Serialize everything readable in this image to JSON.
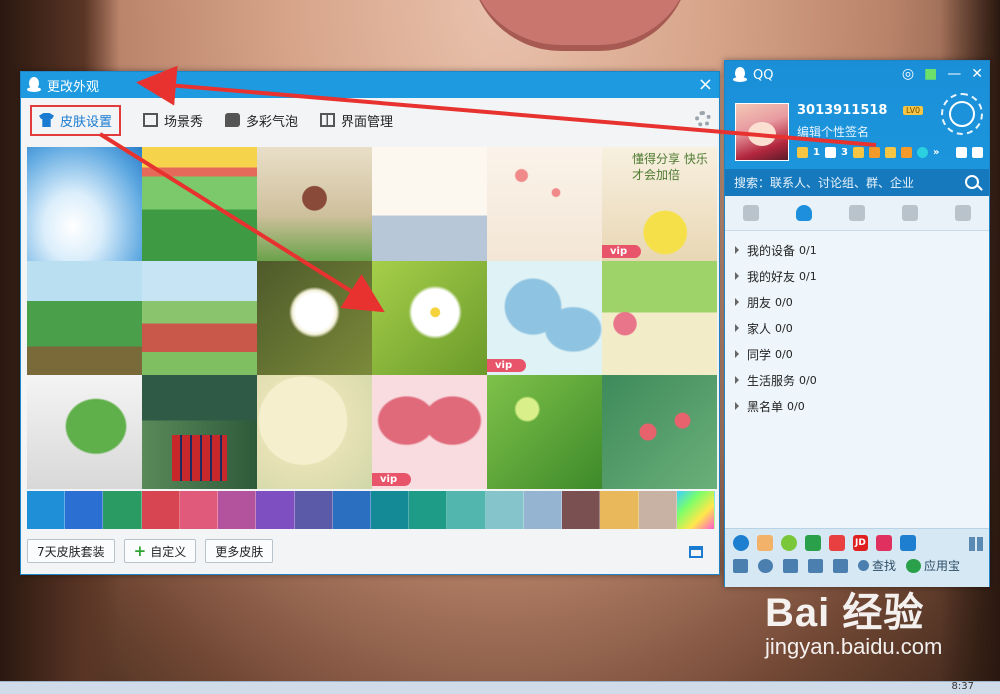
{
  "skin_window": {
    "title": "更改外观",
    "close": "×",
    "tabs": [
      {
        "label": "皮肤设置",
        "active": true
      },
      {
        "label": "场景秀"
      },
      {
        "label": "多彩气泡"
      },
      {
        "label": "界面管理"
      }
    ],
    "vip_label": "vip",
    "tile_text": "懂得分享 快乐才会加倍",
    "buttons": {
      "seven_day": "7天皮肤套装",
      "custom": "自定义",
      "more": "更多皮肤"
    },
    "swatch_colors": [
      "#1f8fd8",
      "#2a6fd1",
      "#2a9c63",
      "#d64551",
      "#e05a7b",
      "#b3529d",
      "#7d4fc0",
      "#5b5aa8",
      "#2b70c0",
      "#138a96",
      "#1f9c88",
      "#52b5ae",
      "#86c4cc",
      "#94b4d2",
      "#7a5050",
      "#e8b85a",
      "#c8b2a4",
      "#ff5bd1"
    ]
  },
  "qq_panel": {
    "title": "QQ",
    "uin": "3013911518",
    "signature": "编辑个性签名",
    "level_badge": "LV0",
    "star_count": "1",
    "mail_count": "3",
    "more_arrow": "»",
    "search_placeholder": "搜索：联系人、讨论组、群、企业",
    "groups": [
      {
        "name": "我的设备",
        "count": "0/1"
      },
      {
        "name": "我的好友",
        "count": "0/1"
      },
      {
        "name": "朋友",
        "count": "0/0"
      },
      {
        "name": "家人",
        "count": "0/0"
      },
      {
        "name": "同学",
        "count": "0/0"
      },
      {
        "name": "生活服务",
        "count": "0/0"
      },
      {
        "name": "黑名单",
        "count": "0/0"
      }
    ],
    "find_label": "查找",
    "app_store_label": "应用宝",
    "jd_label": "JD"
  },
  "watermark": {
    "brand": "Bai 经验",
    "url": "jingyan.baidu.com"
  },
  "taskbar": {
    "clock": "8:37"
  }
}
